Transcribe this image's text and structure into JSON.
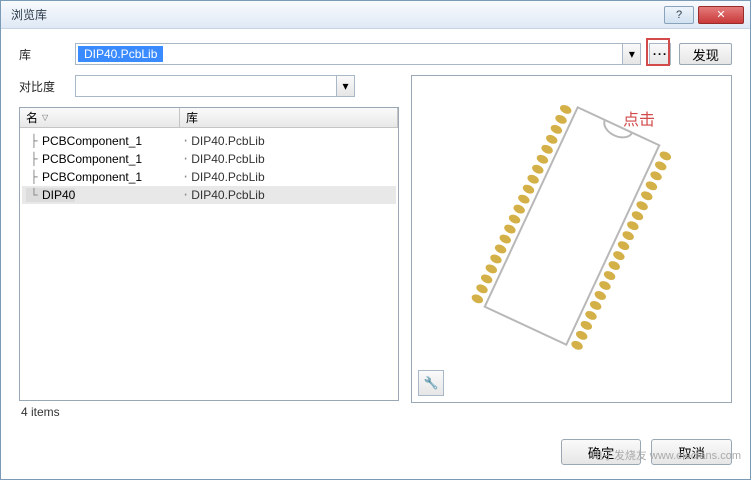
{
  "window": {
    "title": "浏览库",
    "help_glyph": "?",
    "close_glyph": "✕"
  },
  "toolbar": {
    "lib_label": "库",
    "lib_value": "DIP40.PcbLib",
    "browse_glyph": "···",
    "discover_label": "发现",
    "contrast_label": "对比度"
  },
  "list": {
    "headers": {
      "name": "名",
      "lib": "库"
    },
    "rows": [
      {
        "name": "PCBComponent_1",
        "lib": "DIP40.PcbLib",
        "selected": false
      },
      {
        "name": "PCBComponent_1",
        "lib": "DIP40.PcbLib",
        "selected": false
      },
      {
        "name": "PCBComponent_1",
        "lib": "DIP40.PcbLib",
        "selected": false
      },
      {
        "name": "DIP40",
        "lib": "DIP40.PcbLib",
        "selected": true
      }
    ],
    "count_text": "4 items"
  },
  "preview": {
    "annotation": "点击",
    "tool_glyph": "🔧"
  },
  "footer": {
    "ok_label": "确定",
    "cancel_label": "取消"
  },
  "watermark": "电子发烧友 www.elecfans.com"
}
